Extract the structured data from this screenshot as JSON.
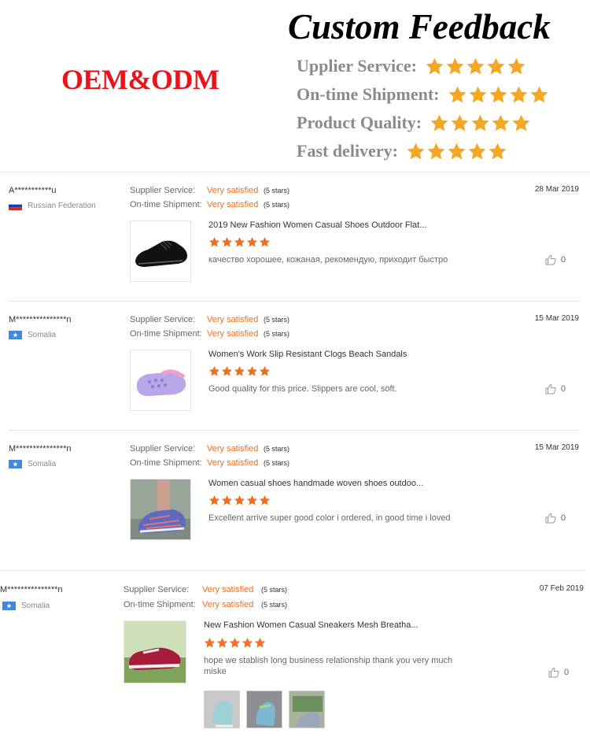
{
  "banner": {
    "brand": "OEM&ODM",
    "title": "Custom Feedback",
    "ratings": [
      {
        "label": "Upplier Service:",
        "stars": 5
      },
      {
        "label": "On-time Shipment:",
        "stars": 5
      },
      {
        "label": "Product Quality:",
        "stars": 5
      },
      {
        "label": "Fast delivery:",
        "stars": 5
      }
    ]
  },
  "colors": {
    "brand_red": "#e8141b",
    "star_orange": "#f5a623",
    "accent_orange": "#f46d1a"
  },
  "reviews": [
    {
      "user": "A***********u",
      "country": "Russian Federation",
      "flag": "russia-flag",
      "supplier_key": "Supplier Service:",
      "supplier_val": "Very satisfied",
      "supplier_stars": "(5 stars)",
      "shipment_key": "On-time Shipment:",
      "shipment_val": "Very satisfied",
      "shipment_stars": "(5 stars)",
      "date": "28 Mar 2019",
      "product": "2019 New Fashion Women Casual Shoes Outdoor Flat...",
      "rating": 5,
      "comment": "качество хорошее, кожаная, рекомендую, приходит быстро",
      "likes": "0"
    },
    {
      "user": "M***************n",
      "country": "Somalia",
      "flag": "somalia-flag",
      "supplier_key": "Supplier Service:",
      "supplier_val": "Very satisfied",
      "supplier_stars": "(5 stars)",
      "shipment_key": "On-time Shipment:",
      "shipment_val": "Very satisfied",
      "shipment_stars": "(5 stars)",
      "date": "15 Mar 2019",
      "product": "Women's Work Slip Resistant Clogs Beach Sandals",
      "rating": 5,
      "comment": "Good quality for this price. Slippers are cool, soft.",
      "likes": "0"
    },
    {
      "user": "M***************n",
      "country": "Somalia",
      "flag": "somalia-flag",
      "supplier_key": "Supplier Service:",
      "supplier_val": "Very satisfied",
      "supplier_stars": "(5 stars)",
      "shipment_key": "On-time Shipment:",
      "shipment_val": "Very satisfied",
      "shipment_stars": "(5 stars)",
      "date": "15 Mar 2019",
      "product": "Women casual shoes handmade woven shoes outdoo...",
      "rating": 5,
      "comment": "Excellent arrive super good color i ordered, in good time i loved",
      "likes": "0"
    },
    {
      "user": "M***************n",
      "country": "Somalia",
      "flag": "somalia-flag",
      "supplier_key": "Supplier Service:",
      "supplier_val": "Very satisfied",
      "supplier_stars": "(5 stars)",
      "shipment_key": "On-time Shipment:",
      "shipment_val": "Very satisfied",
      "shipment_stars": "(5 stars)",
      "date": "07 Feb 2019",
      "product": "New Fashion Women Casual Sneakers Mesh Breatha...",
      "rating": 5,
      "comment": "hope we stablish long business relationship thank you very much miske",
      "likes": "0"
    }
  ]
}
